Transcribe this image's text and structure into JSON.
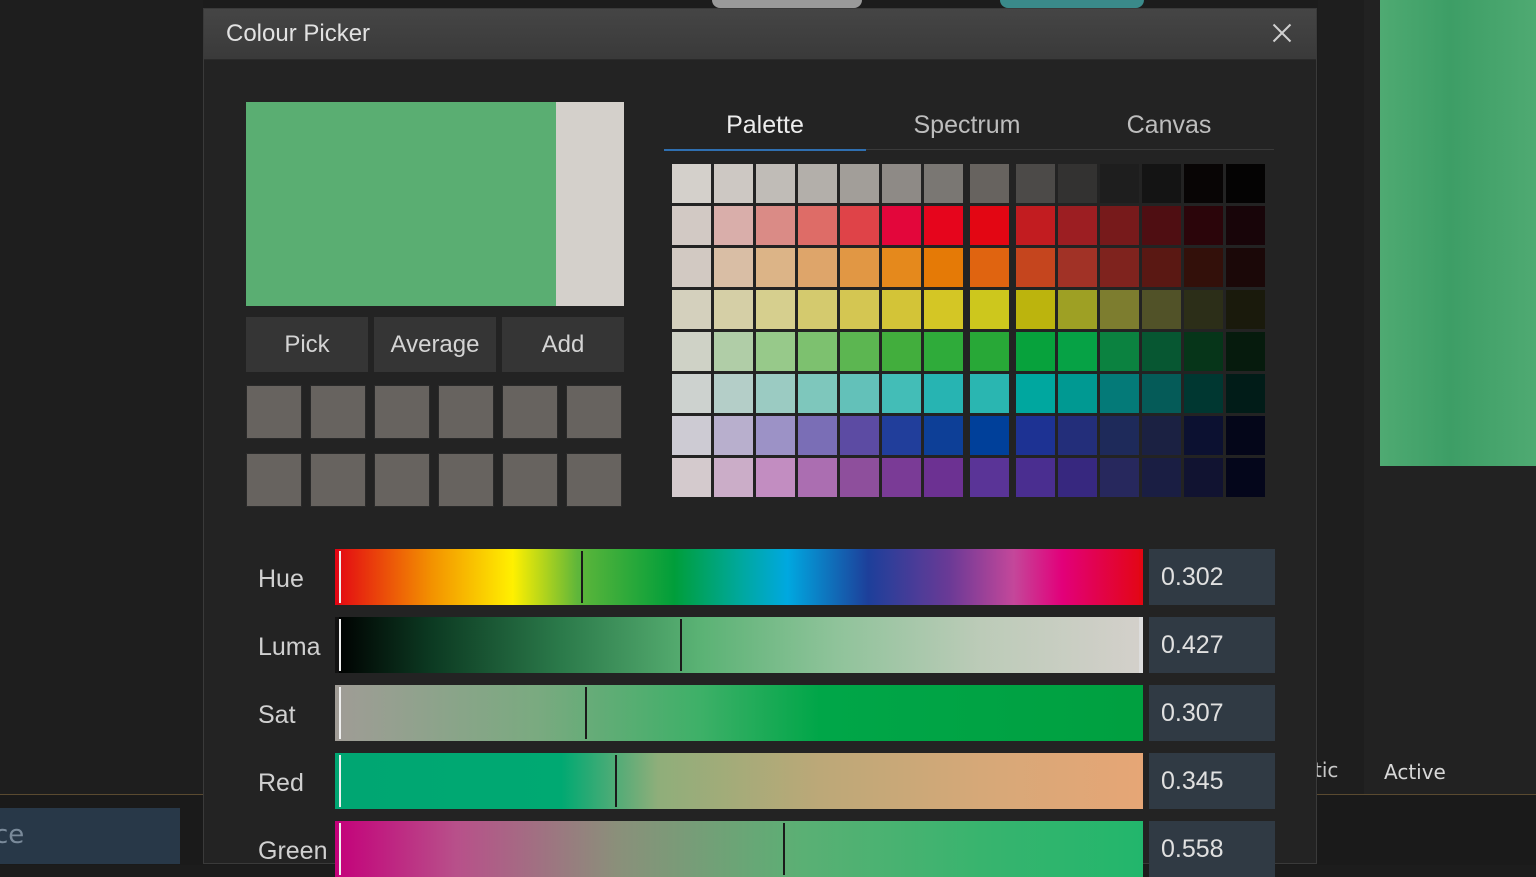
{
  "background": {
    "search_text": "ce",
    "tab_text": "tic",
    "active_label": "Active"
  },
  "dialog": {
    "title": "Colour Picker",
    "close_icon": "close-icon"
  },
  "preview": {
    "new_colour": "#5aae72",
    "old_colour": "#d4d0cb"
  },
  "buttons": {
    "pick": "Pick",
    "average": "Average",
    "add": "Add"
  },
  "tabs": [
    "Palette",
    "Spectrum",
    "Canvas"
  ],
  "active_tab": "Palette",
  "palette": [
    [
      "#d4d0cb",
      "#cdc8c3",
      "#c0bcb7",
      "#b3afaa",
      "#a29e99",
      "#8e8a86",
      "#7a7773",
      "#67635f",
      "#4c4a48",
      "#333231",
      "#1e1e1e",
      "#141414",
      "#080505",
      "#040303"
    ],
    [
      "#d2c9c4",
      "#d9aeaa",
      "#da8b86",
      "#de6c67",
      "#df4348",
      "#e3063b",
      "#e6051c",
      "#e30613",
      "#c21c20",
      "#9c1e22",
      "#771a1b",
      "#4f0e12",
      "#2b050a",
      "#180509"
    ],
    [
      "#d2c9c2",
      "#d9bea5",
      "#dcb487",
      "#dea56a",
      "#e19744",
      "#e5891c",
      "#e57a06",
      "#e06410",
      "#c5451e",
      "#a13226",
      "#7f231e",
      "#5a1813",
      "#33100a",
      "#1b0808"
    ],
    [
      "#d4d0bd",
      "#d5cfa6",
      "#d6cf8e",
      "#d4ca6e",
      "#d4c652",
      "#d3c437",
      "#d4c625",
      "#cdc71d",
      "#bcb40d",
      "#9ea024",
      "#7d7d2f",
      "#515228",
      "#2c2e18",
      "#1a1a0c"
    ],
    [
      "#cfd2c6",
      "#b0cda7",
      "#97c98a",
      "#7dc16f",
      "#5cb651",
      "#42ae3d",
      "#2fab3a",
      "#28a837",
      "#07a23c",
      "#06a245",
      "#0b8240",
      "#075732",
      "#063519",
      "#061b0d"
    ],
    [
      "#cdd2cf",
      "#b4cec8",
      "#9bcbc2",
      "#7ec7bc",
      "#63c1b9",
      "#43bdb7",
      "#27b4b2",
      "#2ab6b1",
      "#00a79f",
      "#009992",
      "#047a78",
      "#055b58",
      "#003731",
      "#011c18"
    ],
    [
      "#cdcbd3",
      "#b8afcd",
      "#9c92c6",
      "#7a6eb6",
      "#5c4ba3",
      "#213e9b",
      "#0d3f97",
      "#00409a",
      "#1d3293",
      "#232e7a",
      "#1e2a5a",
      "#1b2142",
      "#0c1131",
      "#040619"
    ],
    [
      "#d4cacd",
      "#cbadc8",
      "#c28dc1",
      "#ab6eb1",
      "#8e4f9c",
      "#7a3b96",
      "#6c3192",
      "#5a3497",
      "#4a2e90",
      "#37287f",
      "#27285d",
      "#1a1e43",
      "#111331",
      "#04061b"
    ]
  ],
  "sliders": [
    {
      "label": "Hue",
      "value": "0.302"
    },
    {
      "label": "Luma",
      "value": "0.427"
    },
    {
      "label": "Sat",
      "value": "0.307"
    },
    {
      "label": "Red",
      "value": "0.345"
    },
    {
      "label": "Green",
      "value": "0.558"
    }
  ],
  "colors": {
    "accent_tab": "#2f6fb0",
    "value_box": "#303a44"
  }
}
